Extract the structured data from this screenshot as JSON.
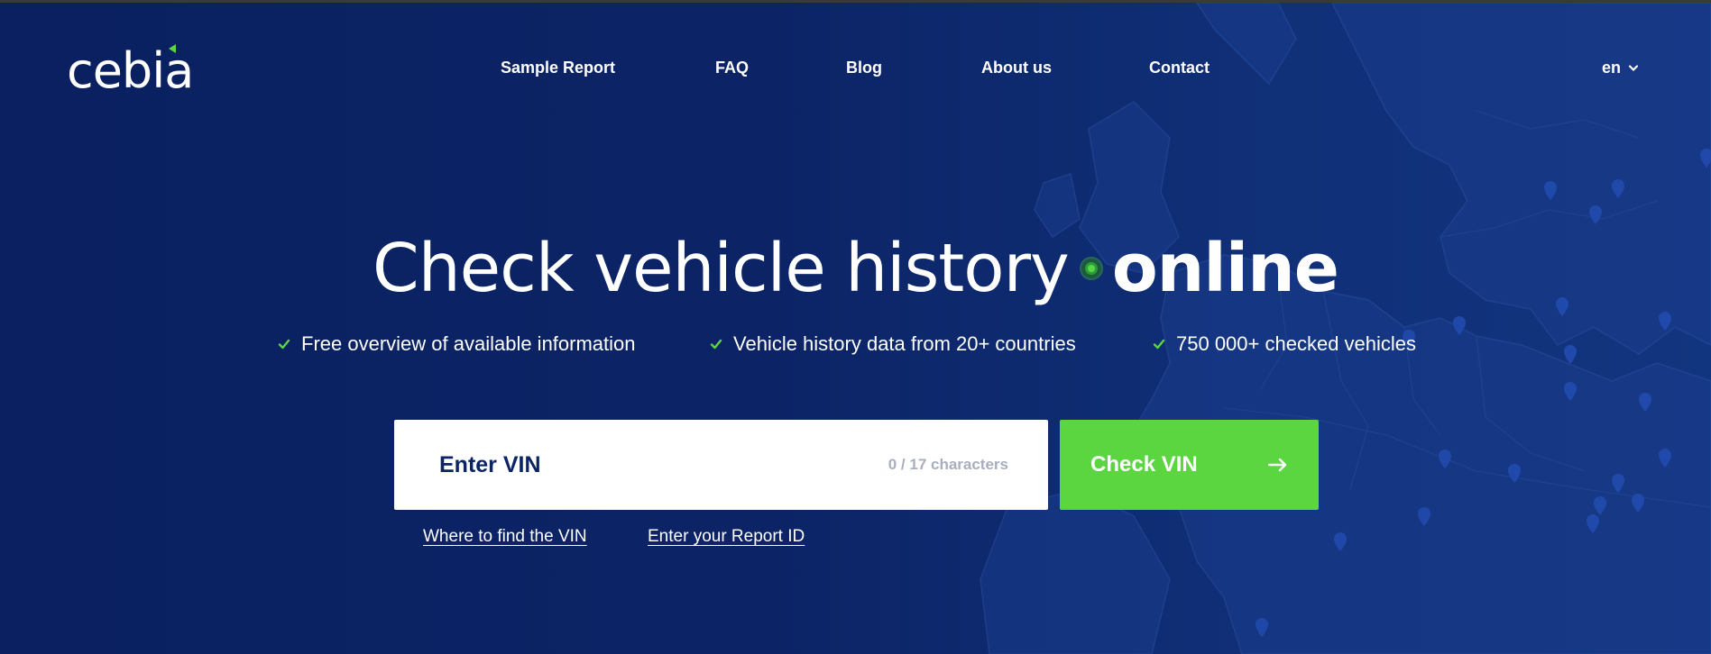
{
  "brand": {
    "logo_text": "cebia",
    "accent_color": "#5bd641",
    "background_color": "#0b2463"
  },
  "nav": {
    "items": [
      {
        "label": "Sample Report"
      },
      {
        "label": "FAQ"
      },
      {
        "label": "Blog"
      },
      {
        "label": "About us"
      },
      {
        "label": "Contact"
      }
    ],
    "language": {
      "label": "en",
      "icon": "chevron-down-icon"
    }
  },
  "hero": {
    "headline_part1": "Check vehicle history",
    "headline_part2": "online",
    "features": [
      {
        "icon": "check-icon",
        "text": "Free overview of available information"
      },
      {
        "icon": "check-icon",
        "text": "Vehicle history data from 20+ countries"
      },
      {
        "icon": "check-icon",
        "text": "750 000+ checked vehicles"
      }
    ]
  },
  "vin_form": {
    "placeholder": "Enter VIN",
    "value": "",
    "char_counter": "0 / 17 characters",
    "submit_label": "Check VIN",
    "submit_icon": "arrow-right-icon",
    "links": [
      {
        "label": "Where to find the VIN"
      },
      {
        "label": "Enter your Report ID"
      }
    ]
  },
  "map": {
    "icon": "map-pin-icon"
  }
}
